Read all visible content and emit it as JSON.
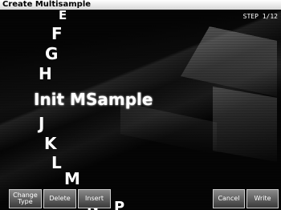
{
  "title": "Create Multisample",
  "step": "STEP 1/12",
  "list": {
    "above": [
      "E",
      "F",
      "G",
      "H"
    ],
    "selected": "Init MSample",
    "below": [
      "J",
      "K",
      "L",
      "M",
      "N",
      "P"
    ]
  },
  "function_keys": [
    "Change\nType",
    "Delete",
    "Insert",
    "Cancel",
    "Write"
  ]
}
